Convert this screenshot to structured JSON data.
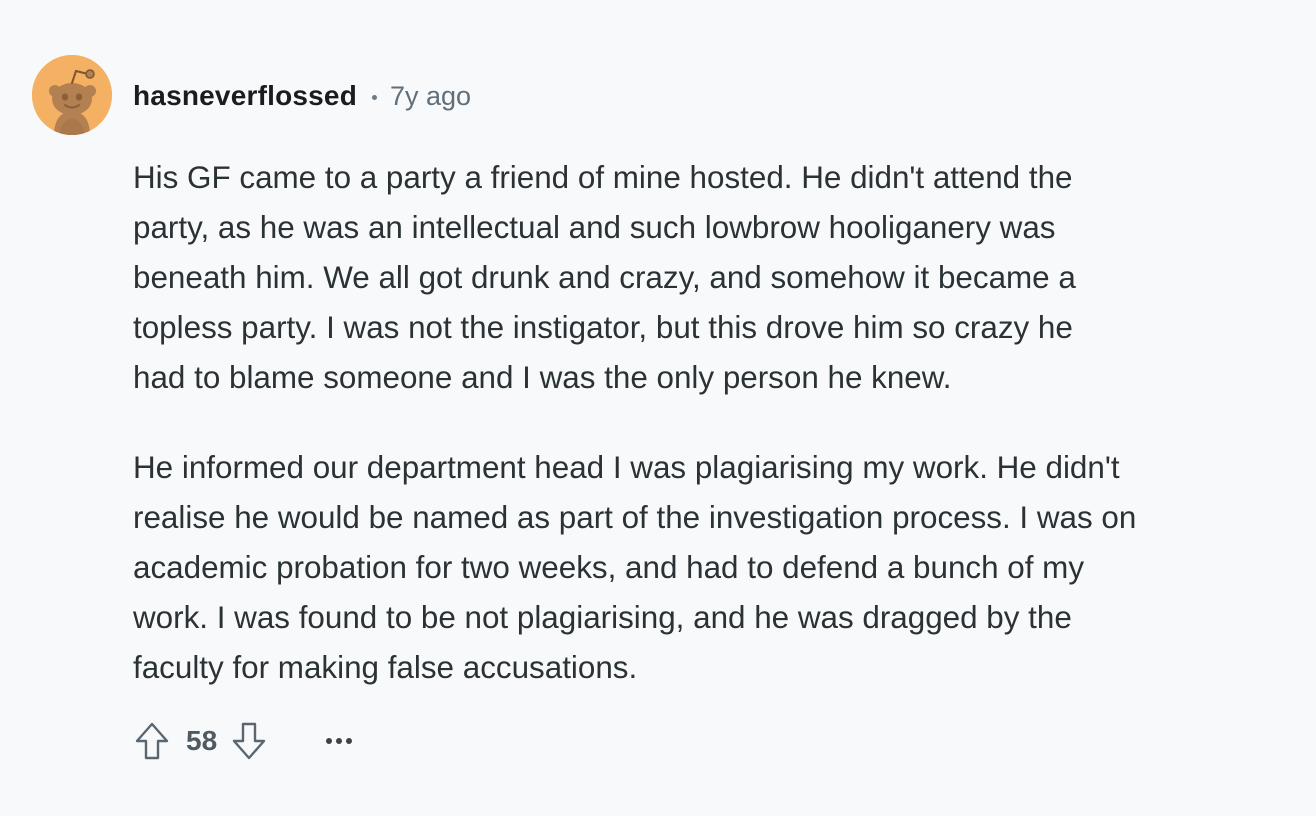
{
  "comment": {
    "username": "hasneverflossed",
    "age": "7y ago",
    "paragraph_1_lines": [
      "His GF came to a party a friend of mine hosted. He didn't attend the",
      "party, as he was an intellectual and such lowbrow hooliganery was",
      "beneath him. We all got drunk and crazy, and somehow it became a",
      "topless party. I was not the instigator, but this drove him so crazy he",
      "had to blame someone and I was the only person he knew."
    ],
    "paragraph_2_lines": [
      "He informed our department head I was plagiarising my work. He didn't",
      "realise he would be named as part of the investigation process. I was on",
      "academic probation for two weeks, and had to defend a bunch of my",
      "work. I was found to be not plagiarising, and he was dragged by the",
      "faculty for making false accusations."
    ],
    "score": "58"
  },
  "icons": {
    "avatar": "snoo-avatar-icon",
    "upvote": "arrow-up-icon",
    "downvote": "arrow-down-icon",
    "more": "ellipsis-icon"
  },
  "colors": {
    "background": "#f8f9fa",
    "avatar_bg": "#f4b163",
    "text": "#2a3236",
    "meta": "#5f6f7b"
  }
}
